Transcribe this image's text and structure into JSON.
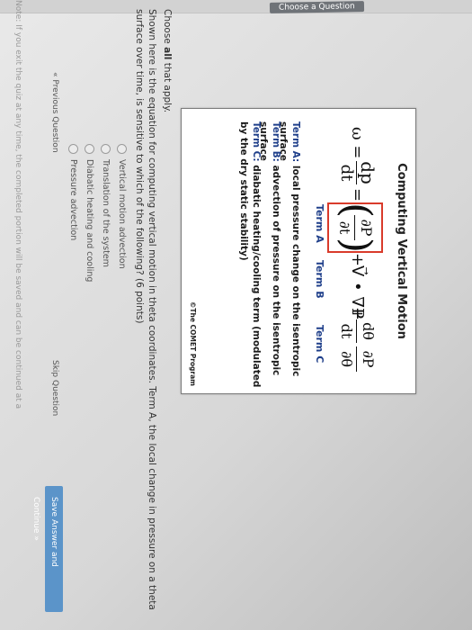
{
  "header": {
    "tab_label": "Choose a Question"
  },
  "figure": {
    "title": "Computing Vertical Motion",
    "equation": {
      "omega": "ω =",
      "dp": "dp",
      "dt": "dt",
      "eq": "=",
      "partial_p": "∂P",
      "partial_t": "∂t",
      "plus1": "+",
      "v_grad": "V⃗ • ∇P",
      "plus2": "+",
      "dtheta": "dθ",
      "dt2": "dt",
      "partial_p2": "∂P",
      "partial_theta": "∂θ",
      "paren_l": "(",
      "paren_r": ")"
    },
    "term_labels": {
      "a": "Term A",
      "b": "Term B",
      "c": "Term C"
    },
    "descriptions": {
      "a_label": "Term A:",
      "a_text": "local pressure change on the isentropic surface",
      "b_label": "Term B:",
      "b_text": "advection of pressure on the isentropic surface",
      "c_label": "Term C:",
      "c_text": "diabatic heating/cooling term (modulated by the dry static stability)"
    },
    "credit": "©The COMET Program"
  },
  "question": {
    "instruction_prefix": "Choose ",
    "instruction_bold": "all",
    "instruction_suffix": " that apply.",
    "text": "Shown here is the equation for computing vertical motion in theta coordinates. Term A, the local change in pressure on a theta surface over time, is sensitive to which of the following? (6 points)"
  },
  "options": [
    "Vertical motion advection",
    "Translation of the system",
    "Diabatic heating and cooling",
    "Pressure advection"
  ],
  "nav": {
    "prev": "« Previous Question",
    "skip": "Skip Question",
    "save": "Save Answer and Continue »"
  },
  "note": "Note: If you exit the quiz at any time, the completed portion will be saved and can be continued at a"
}
